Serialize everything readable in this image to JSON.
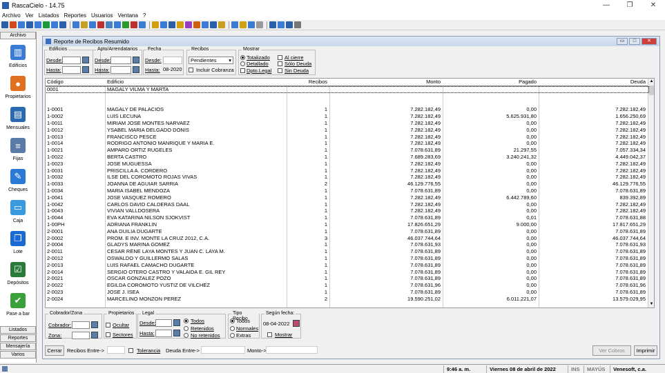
{
  "window": {
    "title": "RascaCielo - 14.75"
  },
  "menu": [
    "Archivo",
    "Ver",
    "Listados",
    "Reportes",
    "Usuarios",
    "Ventana",
    "?"
  ],
  "toolbar_colors": [
    "#2a5ea8",
    "#d04a1a",
    "#3a7bd5",
    "#2a5ea8",
    "#3a7bd5",
    "#1a9a3a",
    "#3a7bd5",
    "#2a5ea8",
    "#3a7bd5",
    "#c8a020",
    "#3a7bd5",
    "#c03030",
    "#4a80c0",
    "#3a7bd5",
    "#2a9a2a",
    "#c03030",
    "#3a7bd5",
    "#d0a010",
    "#3a7bd5",
    "#2a5ea8",
    "#d0a010",
    "#9a3ac0",
    "#d06010",
    "#3a7bd5",
    "#2a5ea8",
    "#c8a020",
    "#3a7bd5",
    "#d0a010",
    "#3a7bd5",
    "#9a9a9a",
    "#2a5ea8",
    "#3a7bd5",
    "#2a5ea8",
    "#777"
  ],
  "nav": {
    "header": "Archivo",
    "items": [
      {
        "label": "Edificios",
        "icon": "building-icon",
        "color": "#3a7bd5",
        "glyph": "▥"
      },
      {
        "label": "Propietarios",
        "icon": "people-icon",
        "color": "#e07020",
        "glyph": "●"
      },
      {
        "label": "Mensuales",
        "icon": "doc-add-icon",
        "color": "#2a6ab0",
        "glyph": "▤"
      },
      {
        "label": "Fijas",
        "icon": "document-icon",
        "color": "#5a7aa8",
        "glyph": "≡"
      },
      {
        "label": "Cheques",
        "icon": "pencil-icon",
        "color": "#2a7ad5",
        "glyph": "✎"
      },
      {
        "label": "Caja",
        "icon": "monitor-icon",
        "color": "#3a9ae0",
        "glyph": "▭"
      },
      {
        "label": "Lote",
        "icon": "stack-icon",
        "color": "#1a6ad5",
        "glyph": "❐"
      },
      {
        "label": "Depósitos",
        "icon": "checkbox-icon",
        "color": "#2a7a3a",
        "glyph": "☑"
      },
      {
        "label": "Pase a bar",
        "icon": "checkmark-icon",
        "color": "#3aa03a",
        "glyph": "✔"
      }
    ],
    "bottom": [
      "Listados",
      "Reportes",
      "Mensajería",
      "Varios"
    ]
  },
  "panel": {
    "title": "Reporte de Recibos Resumido"
  },
  "filters": {
    "edificios": {
      "legend": "Edificios",
      "desde_label": "Desde:",
      "desde_value": "",
      "hasta_label": "Hasta:",
      "hasta_value": ""
    },
    "apto": {
      "legend": "Apto/Arrendatarios",
      "desde_label": "Desde:",
      "hasta_label": "Hasta:"
    },
    "fecha": {
      "legend": "Fecha",
      "desde_label": "Desde:",
      "hasta_label": "Hasta:",
      "hasta_value": "08-2020"
    },
    "recibos": {
      "legend": "Recibos",
      "select_value": "Pendientes",
      "incluir": "Incluir Cobranza"
    },
    "mostrar": {
      "legend": "Mostrar",
      "totalizado": "Totalizado",
      "detallado": "Detallado",
      "dpto": "Dpto.Legal",
      "al_cierre": "Al cierre",
      "solo_deuda": "Sólo Deuda",
      "sin_deuda": "Sin Deuda"
    }
  },
  "table": {
    "headers": [
      "Código",
      "Edificio",
      "Recibos",
      "Monto",
      "Pagado",
      "Deuda"
    ],
    "rows": [
      [
        "0001",
        "MAGALY VILMA Y MARTA",
        "",
        "",
        "",
        ""
      ],
      [
        "",
        "",
        "",
        "",
        "",
        ""
      ],
      [
        "",
        "",
        "",
        "",
        "",
        ""
      ],
      [
        "1-0001",
        "MAGALY DE PALACIOS",
        "1",
        "7.282.182,49",
        "0,00",
        "7.282.182,49"
      ],
      [
        "1-0002",
        "LUIS LECUNA",
        "1",
        "7.282.182,49",
        "5.625.931,80",
        "1.656.250,69"
      ],
      [
        "1-0011",
        "MIRIAM JOSE MONTES NARVAEZ",
        "1",
        "7.282.182,49",
        "0,00",
        "7.282.182,49"
      ],
      [
        "1-0012",
        "YSABEL MARIA DELGADO DONIS",
        "1",
        "7.282.182,49",
        "0,00",
        "7.282.182,49"
      ],
      [
        "1-0013",
        "FRANCISCO PESCE",
        "1",
        "7.282.182,49",
        "0,00",
        "7.282.182,49"
      ],
      [
        "1-0014",
        "RODRIGO ANTONIO MANRIQUE Y MARIA E.",
        "1",
        "7.282.182,49",
        "0,00",
        "7.282.182,49"
      ],
      [
        "1-0021",
        "AMPARO ORTIZ RUGELES",
        "1",
        "7.078.631,89",
        "21.297,55",
        "7.057.334,34"
      ],
      [
        "1-0022",
        "BERTA CASTRO",
        "1",
        "7.689.283,69",
        "3.240.241,32",
        "4.449.042,37"
      ],
      [
        "1-0023",
        "JOSE MUGUESSA",
        "1",
        "7.282.182,49",
        "0,00",
        "7.282.182,49"
      ],
      [
        "1-0031",
        "PRISCILLA A. CORDERO",
        "1",
        "7.282.182,49",
        "0,00",
        "7.282.182,49"
      ],
      [
        "1-0032",
        "ILSE DEL COROMOTO ROJAS VIVAS",
        "1",
        "7.282.182,49",
        "0,00",
        "7.282.182,49"
      ],
      [
        "1-0033",
        "JOANNA DE AGUIAR SARRIA",
        "2",
        "46.129.776,55",
        "0,00",
        "46.129.776,55"
      ],
      [
        "1-0034",
        "MARIA ISABEL MENDOZA",
        "1",
        "7.078.631,89",
        "0,00",
        "7.078.631,89"
      ],
      [
        "1-0041",
        "JOSE VASQUEZ ROMERO",
        "1",
        "7.282.182,49",
        "6.442.789,60",
        "839.392,89"
      ],
      [
        "1-0042",
        "CARLOS DAVID CALDERAS DAAL",
        "1",
        "7.282.182,49",
        "0,00",
        "7.282.182,49"
      ],
      [
        "1-0043",
        "VIVIAN VALLDOSERA",
        "1",
        "7.282.182,49",
        "0,00",
        "7.282.182,49"
      ],
      [
        "1-0044",
        "EVA KATARINA NILSON SJOKVIST",
        "1",
        "7.078.631,89",
        "0,01",
        "7.078.631,88"
      ],
      [
        "1-00PH",
        "ADRIANA FRANKLIN",
        "1",
        "17.826.651,29",
        "9.000,00",
        "17.817.651,29"
      ],
      [
        "2-0001",
        "ANA DUILIA DUGARTE",
        "1",
        "7.078.631,89",
        "0,00",
        "7.078.631,89"
      ],
      [
        "2-0002",
        "PROM. E INV. MONTE LA CRUZ 2012, C.A.",
        "3",
        "46.037.744,64",
        "0,00",
        "46.037.744,64"
      ],
      [
        "2-0004",
        "GLADYS MARINA GOMEZ",
        "1",
        "7.078.631,93",
        "0,00",
        "7.078.631,93"
      ],
      [
        "2-0011",
        "CESAR RENE LAYA MONTES Y JUAN C. LAYA M.",
        "1",
        "7.078.631,89",
        "0,00",
        "7.078.631,89"
      ],
      [
        "2-0012",
        "OSWALDO Y GUILLERMO SALAS",
        "1",
        "7.078.631,89",
        "0,00",
        "7.078.631,89"
      ],
      [
        "2-0013",
        "LUIS RAFAEL CAMACHO DUGARTE",
        "1",
        "7.078.631,89",
        "0,00",
        "7.078.631,89"
      ],
      [
        "2-0014",
        "SERGIO OTERO CASTRO Y VALAIDA E. GIL REY",
        "1",
        "7.078.631,89",
        "0,00",
        "7.078.631,89"
      ],
      [
        "2-0021",
        "OSCAR GONZALEZ POZO",
        "1",
        "7.078.631,89",
        "0,00",
        "7.078.631,89"
      ],
      [
        "2-0022",
        "EGILDA COROMOTO YUSTIZ DE VILCHEZ",
        "1",
        "7.078.631,96",
        "0,00",
        "7.078.631,96"
      ],
      [
        "2-0023",
        "JOSE J. ISEA",
        "1",
        "7.078.631,89",
        "0,00",
        "7.078.631,89"
      ],
      [
        "2-0024",
        "MARCELINO MONZON PEREZ",
        "2",
        "19.590.251,02",
        "6.011.221,07",
        "13.579.029,95"
      ]
    ]
  },
  "bottom_filters": {
    "cobrador": {
      "legend": "Cobrador/Zona",
      "cobrador_label": "Cobrador:",
      "zona_label": "Zona:"
    },
    "propietarios": {
      "legend": "Propietarios",
      "ocultar": "Ocultar",
      "sectores": "Sectores"
    },
    "legal": {
      "legend": "Legal",
      "desde_label": "Desde:",
      "hasta_label": "Hasta:",
      "todos": "Todos",
      "retenidos": "Retenidos",
      "no_retenidos": "No retenidos"
    },
    "tipo": {
      "legend": "Tipo Recibo",
      "todos": "Todos",
      "normales": "Normales",
      "extras": "Extras"
    },
    "segun": {
      "legend": "Según fecha:",
      "date": "08-04-2022",
      "mostrar": "Mostrar"
    }
  },
  "actions": {
    "cerrar": "Cerrar",
    "recibos_entre": "Recibos Entre->",
    "tolerancia": "Tolerancia",
    "deuda_entre": "Deuda Entre->",
    "monto": "Monto->",
    "ver_cobros": "Ver Cobros",
    "imprimir": "Imprimir"
  },
  "statusbar": {
    "time": "9:46 a. m.",
    "date": "Viernes 08 de abril de 2022",
    "ins": "INS",
    "mayus": "MAYÚS",
    "company": "Venesoft, c.a."
  }
}
